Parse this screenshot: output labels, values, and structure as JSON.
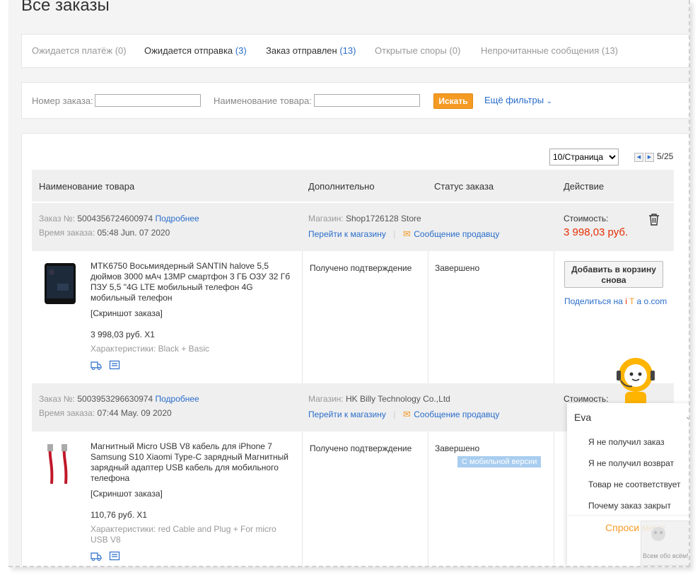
{
  "page": {
    "title": "Все заказы"
  },
  "tabs": [
    {
      "label": "Ожидается платёж",
      "count": "(0)"
    },
    {
      "label": "Ожидается отправка",
      "count": "(3)"
    },
    {
      "label": "Заказ отправлен",
      "count": "(13)"
    },
    {
      "label": "Открытые споры",
      "count": "(0)"
    },
    {
      "label": "Непрочитанные сообщения",
      "count": "(13)"
    }
  ],
  "filters": {
    "order_number_label": "Номер заказа:",
    "order_number_value": "",
    "product_name_label": "Наименование товара:",
    "product_name_value": "",
    "search_label": "Искать",
    "more_filters_label": "Ещё фильтры"
  },
  "pager": {
    "per_page": "10/Страница",
    "page_text": "5/25"
  },
  "table_header": {
    "product": "Наименование товара",
    "additional": "Дополнительно",
    "status": "Статус заказа",
    "action": "Действие"
  },
  "orders": [
    {
      "order_no_label": "Заказ №:",
      "order_no": "5004356724600974",
      "details_link": "Подробнее",
      "time_label": "Время заказа:",
      "time": "05:48 Jun. 07 2020",
      "store_label": "Магазин:",
      "store": "Shop1726128 Store",
      "go_to_store": "Перейти к магазину",
      "message_seller": "Сообщение продавцу",
      "cost_label": "Стоимость:",
      "cost": "3 998,03 руб.",
      "product_title": "MTK6750 Восьмиядерный SANTIN halove 5,5 дюймов 3000 мАч 13MP смартфон 3 ГБ ОЗУ 32 Гб ПЗУ 5,5 \"4G LTE мобильный телефон 4G мобильный телефон",
      "screenshot": "[Скриншот заказа]",
      "price_qty": "3 998,03 руб. X1",
      "specs": "Характеристики: Black + Basic",
      "additional": "Получено подтверждение",
      "status": "Завершено",
      "add_to_cart": "Добавить в корзину снова",
      "share_prefix": "Поделиться на",
      "share_i": "i",
      "share_t": "T",
      "share_a": "a",
      "share_o": "o.com"
    },
    {
      "order_no_label": "Заказ №:",
      "order_no": "5003953296630974",
      "details_link": "Подробнее",
      "time_label": "Время заказа:",
      "time": "07:44 May. 09 2020",
      "store_label": "Магазин:",
      "store": "HK Billy Technology Co.,Ltd",
      "go_to_store": "Перейти к магазину",
      "message_seller": "Сообщение продавцу",
      "cost_label": "Стоимость:",
      "product_title": "Магнитный Micro USB V8 кабель для iPhone 7 Samsung S10 Xiaomi Type-C зарядный Магнитный зарядный адаптер USB кабель для мобильного телефона",
      "screenshot": "[Скриншот заказа]",
      "price_qty": "110,76 руб. X1",
      "specs": "Характеристики: red Cable and Plug + For micro USB V8",
      "additional": "Получено подтверждение",
      "status": "Завершено",
      "mobile_tag": "С мобильной версии"
    }
  ],
  "chat": {
    "name": "Eva",
    "items": [
      "Я не получил заказ",
      "Я не получил возврат",
      "Товар не соответствует",
      "Почему заказ закрыт"
    ],
    "ask_me": "Спроси меня",
    "watermark": "Всем обо всём!"
  },
  "colors": {
    "accent": "#f59a23",
    "link": "#2a6dca",
    "price": "#e62e04",
    "tag": "#a8cdef"
  }
}
